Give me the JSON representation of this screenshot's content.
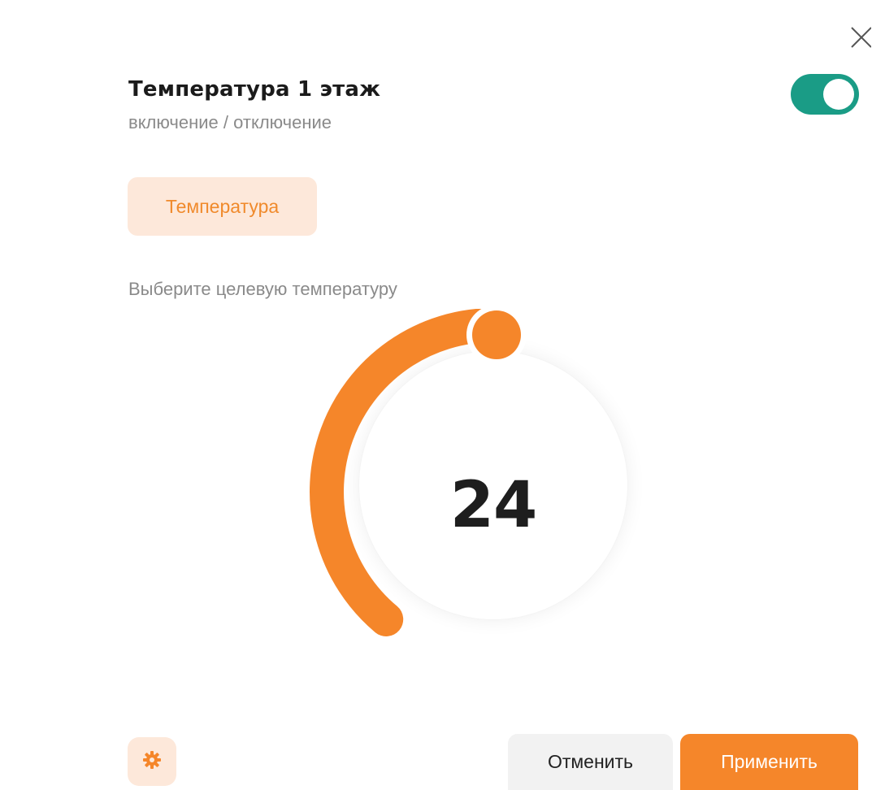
{
  "dialog": {
    "title": "Температура 1 этаж",
    "subtitle": "включение / отключение",
    "close_icon": "close-icon",
    "power_toggle": {
      "on": true,
      "color": "#1a9c86"
    }
  },
  "tabs": [
    {
      "label": "Температура",
      "active": true
    }
  ],
  "thermostat": {
    "prompt": "Выберите целевую температуру",
    "value": "24",
    "level": 0.5,
    "accent_color": "#f5862a"
  },
  "footer": {
    "settings_icon": "gear-icon",
    "cancel_label": "Отменить",
    "apply_label": "Применить"
  }
}
